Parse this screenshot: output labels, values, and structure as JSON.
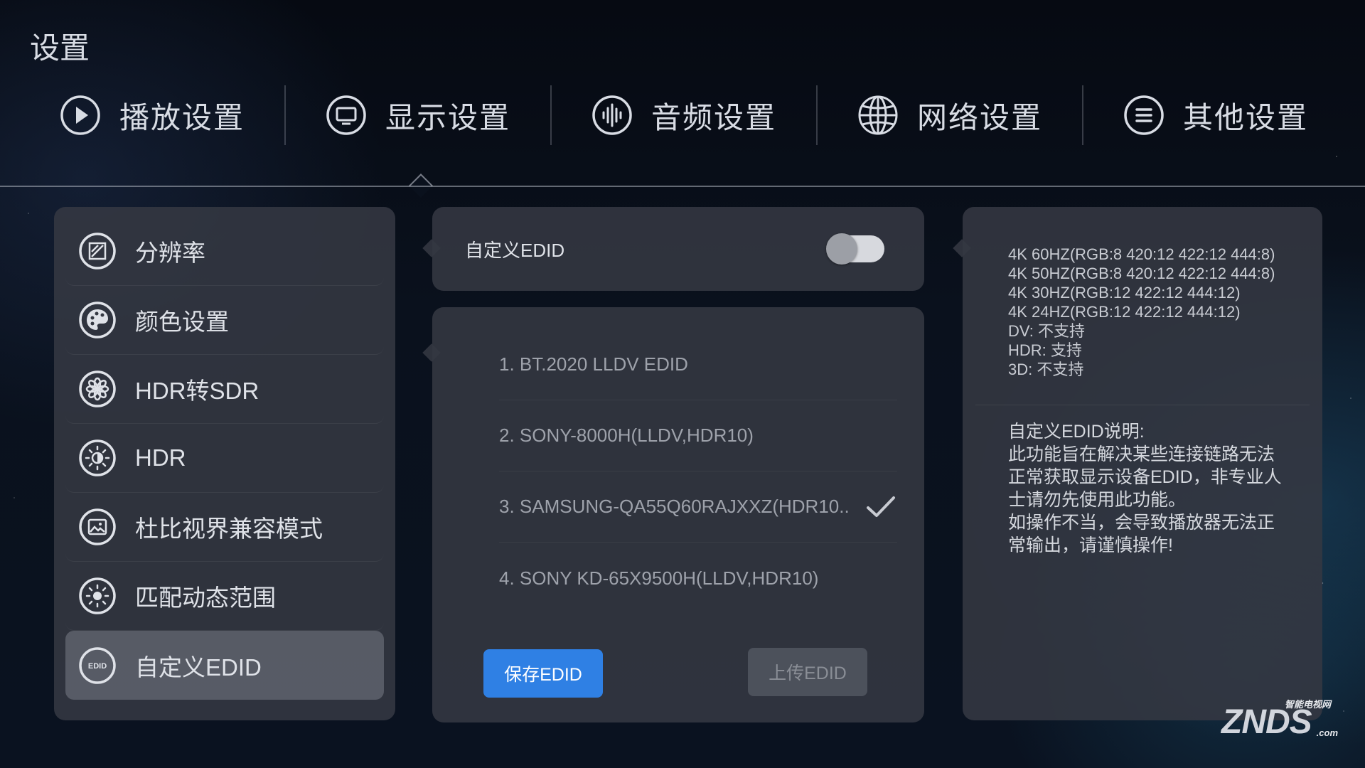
{
  "page": {
    "title": "设置"
  },
  "tabs": [
    {
      "label": "播放设置",
      "icon": "play-icon"
    },
    {
      "label": "显示设置",
      "icon": "display-icon"
    },
    {
      "label": "音频设置",
      "icon": "audio-icon"
    },
    {
      "label": "网络设置",
      "icon": "globe-icon"
    },
    {
      "label": "其他设置",
      "icon": "menu-icon"
    }
  ],
  "active_tab": 1,
  "sidebar": {
    "items": [
      {
        "label": "分辨率",
        "icon": "resolution-icon"
      },
      {
        "label": "颜色设置",
        "icon": "palette-icon"
      },
      {
        "label": "HDR转SDR",
        "icon": "hdr-convert-icon"
      },
      {
        "label": "HDR",
        "icon": "hdr-icon"
      },
      {
        "label": "杜比视界兼容模式",
        "icon": "dolby-vision-icon"
      },
      {
        "label": "匹配动态范围",
        "icon": "brightness-icon"
      },
      {
        "label": "自定义EDID",
        "icon": "edid-icon",
        "icon_text": "EDID"
      }
    ],
    "active_index": 6
  },
  "custom_edid": {
    "label": "自定义EDID",
    "enabled": false
  },
  "edid_list": {
    "items": [
      {
        "label": "1. BT.2020 LLDV EDID",
        "selected": false
      },
      {
        "label": "2. SONY-8000H(LLDV,HDR10)",
        "selected": false
      },
      {
        "label": "3. SAMSUNG-QA55Q60RAJXXZ(HDR10..",
        "selected": true
      },
      {
        "label": "4. SONY KD-65X9500H(LLDV,HDR10)",
        "selected": false
      }
    ],
    "save_button": "保存EDID",
    "upload_button": "上传EDID"
  },
  "info": {
    "specs": [
      "4K 60HZ(RGB:8 420:12 422:12 444:8)",
      "4K 50HZ(RGB:8 420:12 422:12 444:8)",
      "4K 30HZ(RGB:12 422:12 444:12)",
      "4K 24HZ(RGB:12 422:12 444:12)",
      "DV: 不支持",
      "HDR: 支持",
      "3D: 不支持"
    ],
    "description_lines": [
      "自定义EDID说明:",
      "此功能旨在解决某些连接链路无法",
      "正常获取显示设备EDID，非专业人",
      "士请勿先使用此功能。",
      "如操作不当，会导致播放器无法正",
      "常输出，请谨慎操作!"
    ]
  },
  "watermark": {
    "top": "智能电视网",
    "main": "ZNDS",
    "suffix": ".com"
  },
  "colors": {
    "accent": "#2f80e4",
    "panel": "#343842",
    "background": "#0a111d"
  }
}
